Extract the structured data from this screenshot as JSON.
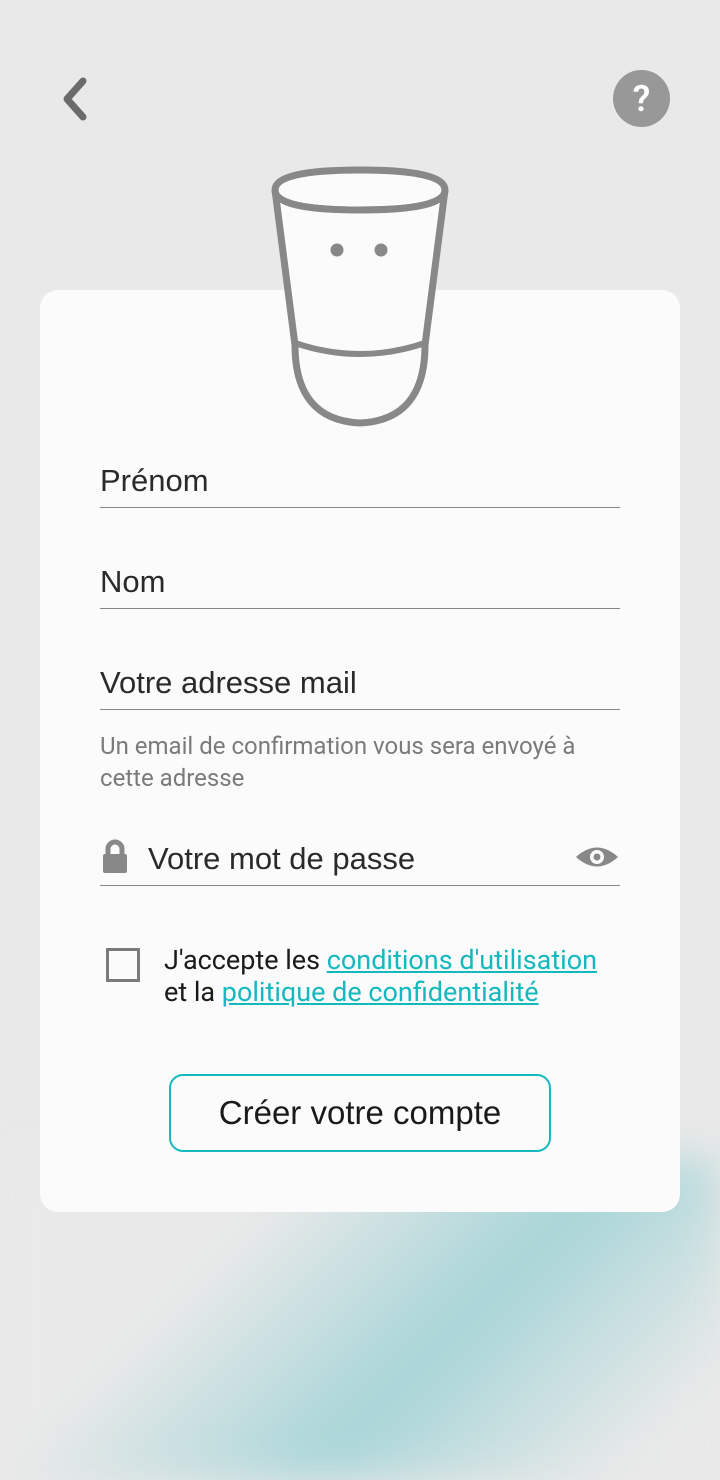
{
  "header": {
    "back_icon": "chevron-left",
    "help_label": "?"
  },
  "form": {
    "first_name_placeholder": "Prénom",
    "last_name_placeholder": "Nom",
    "email_placeholder": "Votre adresse mail",
    "email_helper": "Un email de confirmation vous sera envoyé à cette adresse",
    "password_placeholder": "Votre mot de passe",
    "consent_prefix": "J'accepte les ",
    "terms_link": "conditions d'utilisation",
    "consent_mid": " et la ",
    "privacy_link": "politique de confidentialité",
    "submit_label": "Créer votre compte"
  },
  "colors": {
    "accent": "#14b8bf",
    "icon_gray": "#888888"
  }
}
